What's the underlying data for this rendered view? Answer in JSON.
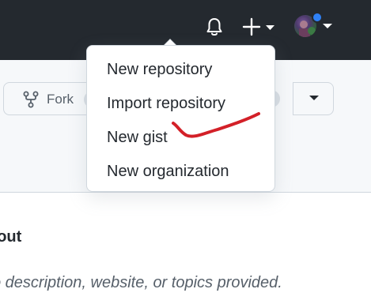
{
  "topbar": {
    "notifications_icon": "bell-icon",
    "create_icon": "plus-icon",
    "avatar_icon": "avatar",
    "colors": {
      "background": "#24292f",
      "icon": "#ffffff",
      "avatar_badge": "#2f81f7"
    }
  },
  "create_menu": {
    "items": [
      {
        "label": "New repository"
      },
      {
        "label": "Import repository"
      },
      {
        "label": "New gist"
      },
      {
        "label": "New organization"
      }
    ],
    "annotation_color": "#d32028"
  },
  "repo_actions": {
    "fork_label": "Fork",
    "fork_icon": "repo-forked-icon",
    "dropdown_icon": "triangle-down-icon"
  },
  "about": {
    "heading": "bout",
    "description": "o description, website, or topics provided."
  }
}
